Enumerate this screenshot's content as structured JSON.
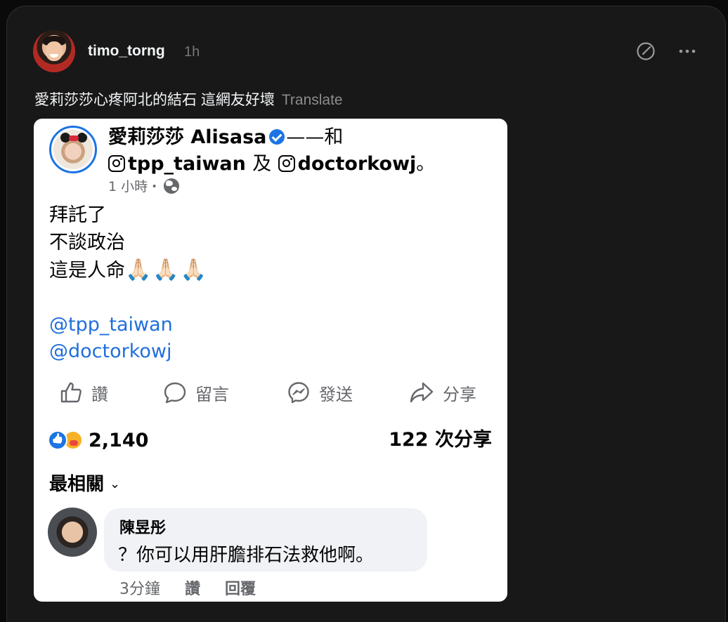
{
  "post": {
    "username": "timo_torng",
    "time": "1h",
    "caption": "愛莉莎莎心疼阿北的結石 這網友好壞",
    "translate_label": "Translate"
  },
  "icons": {
    "compose": "compose-circle-icon",
    "more": "more-horizontal-icon"
  },
  "screenshot": {
    "author": "愛莉莎莎 Alisasa",
    "with_text": "——和",
    "tag1": "tpp_taiwan",
    "conjunction": "及",
    "tag2": "doctorkowj",
    "tag_end": "。",
    "time": "1 小時・",
    "body": [
      "拜託了",
      "不談政治",
      "這是人命"
    ],
    "emoji": "🙏🏻🙏🏻🙏🏻",
    "mentions": [
      "@tpp_taiwan",
      "@doctorkowj"
    ],
    "actions": {
      "like": "讚",
      "comment": "留言",
      "send": "發送",
      "share": "分享"
    },
    "reaction_count": "2,140",
    "share_count": "122 次分享",
    "sort_label": "最相關",
    "sort_chevron": "⌄",
    "comment": {
      "author": "陳昱彤",
      "text": "？你可以用肝膽排石法救他啊。",
      "time": "3分鐘",
      "like": "讚",
      "reply": "回覆"
    }
  },
  "colors": {
    "background": "#181818",
    "fb_blue": "#1b74e4",
    "mention_blue": "#216fdb",
    "muted": "#65676b"
  }
}
